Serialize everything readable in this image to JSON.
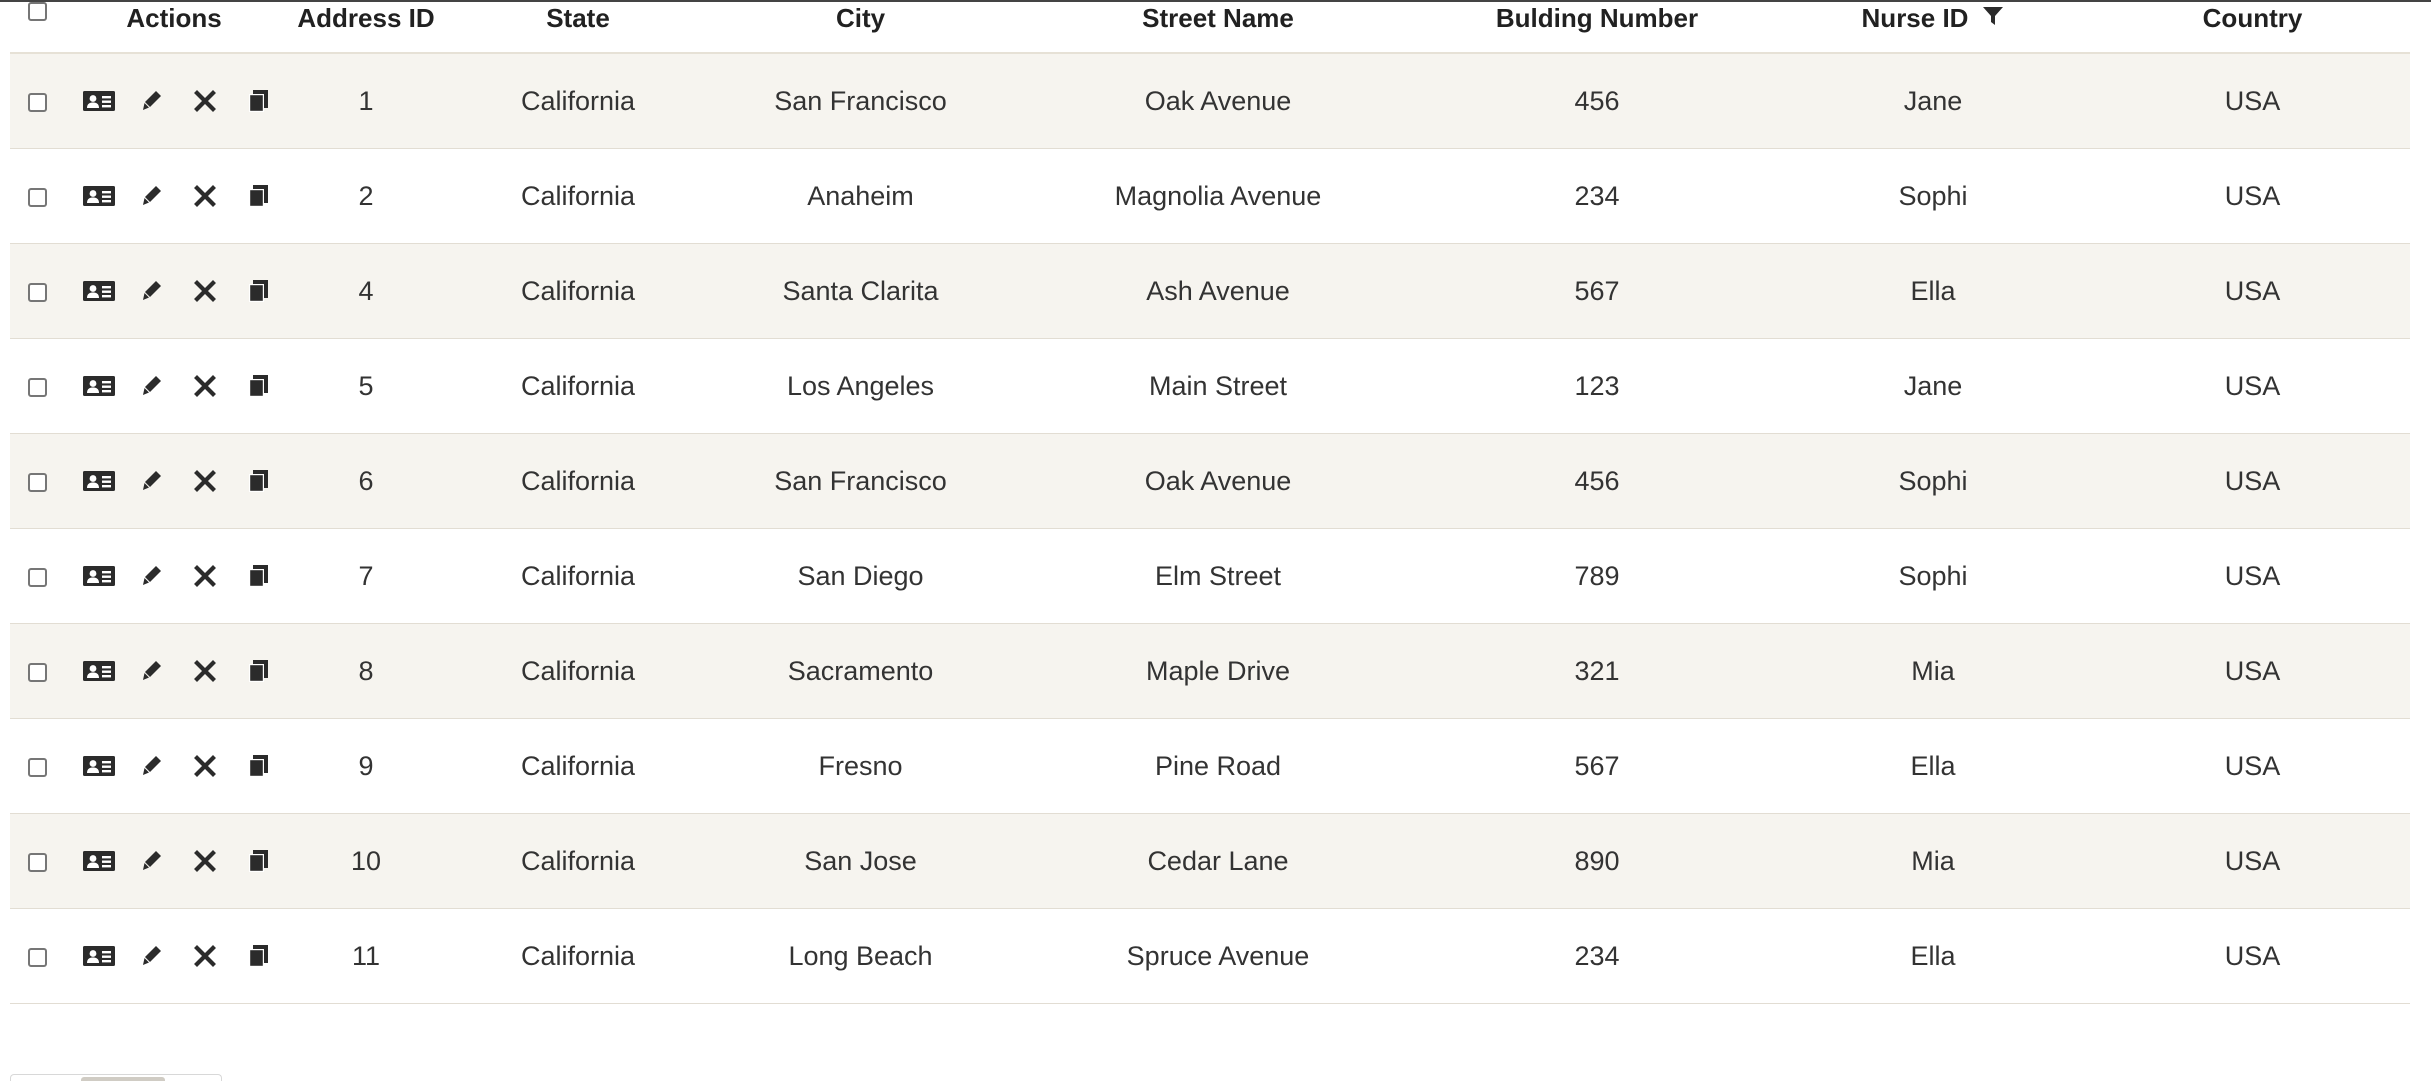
{
  "columns": {
    "actions": "Actions",
    "address_id": "Address ID",
    "state": "State",
    "city": "City",
    "street_name": "Street Name",
    "building_number": "Bulding Number",
    "nurse_id": "Nurse ID",
    "country": "Country"
  },
  "icons": {
    "view": "id-card-icon",
    "edit": "pencil-icon",
    "delete": "close-x-icon",
    "copy": "copy-icon",
    "filter": "filter-funnel-icon"
  },
  "colors": {
    "row_alt": "#f6f4ef",
    "row_plain": "#ffffff",
    "icon": "#2b2b2b"
  },
  "rows": [
    {
      "address_id": "1",
      "state": "California",
      "city": "San Francisco",
      "street_name": "Oak Avenue",
      "building_number": "456",
      "nurse_id": "Jane",
      "country": "USA"
    },
    {
      "address_id": "2",
      "state": "California",
      "city": "Anaheim",
      "street_name": "Magnolia Avenue",
      "building_number": "234",
      "nurse_id": "Sophi",
      "country": "USA"
    },
    {
      "address_id": "4",
      "state": "California",
      "city": "Santa Clarita",
      "street_name": "Ash Avenue",
      "building_number": "567",
      "nurse_id": "Ella",
      "country": "USA"
    },
    {
      "address_id": "5",
      "state": "California",
      "city": "Los Angeles",
      "street_name": "Main Street",
      "building_number": "123",
      "nurse_id": "Jane",
      "country": "USA"
    },
    {
      "address_id": "6",
      "state": "California",
      "city": "San Francisco",
      "street_name": "Oak Avenue",
      "building_number": "456",
      "nurse_id": "Sophi",
      "country": "USA"
    },
    {
      "address_id": "7",
      "state": "California",
      "city": "San Diego",
      "street_name": "Elm Street",
      "building_number": "789",
      "nurse_id": "Sophi",
      "country": "USA"
    },
    {
      "address_id": "8",
      "state": "California",
      "city": "Sacramento",
      "street_name": "Maple Drive",
      "building_number": "321",
      "nurse_id": "Mia",
      "country": "USA"
    },
    {
      "address_id": "9",
      "state": "California",
      "city": "Fresno",
      "street_name": "Pine Road",
      "building_number": "567",
      "nurse_id": "Ella",
      "country": "USA"
    },
    {
      "address_id": "10",
      "state": "California",
      "city": "San Jose",
      "street_name": "Cedar Lane",
      "building_number": "890",
      "nurse_id": "Mia",
      "country": "USA"
    },
    {
      "address_id": "11",
      "state": "California",
      "city": "Long Beach",
      "street_name": "Spruce Avenue",
      "building_number": "234",
      "nurse_id": "Ella",
      "country": "USA"
    }
  ]
}
